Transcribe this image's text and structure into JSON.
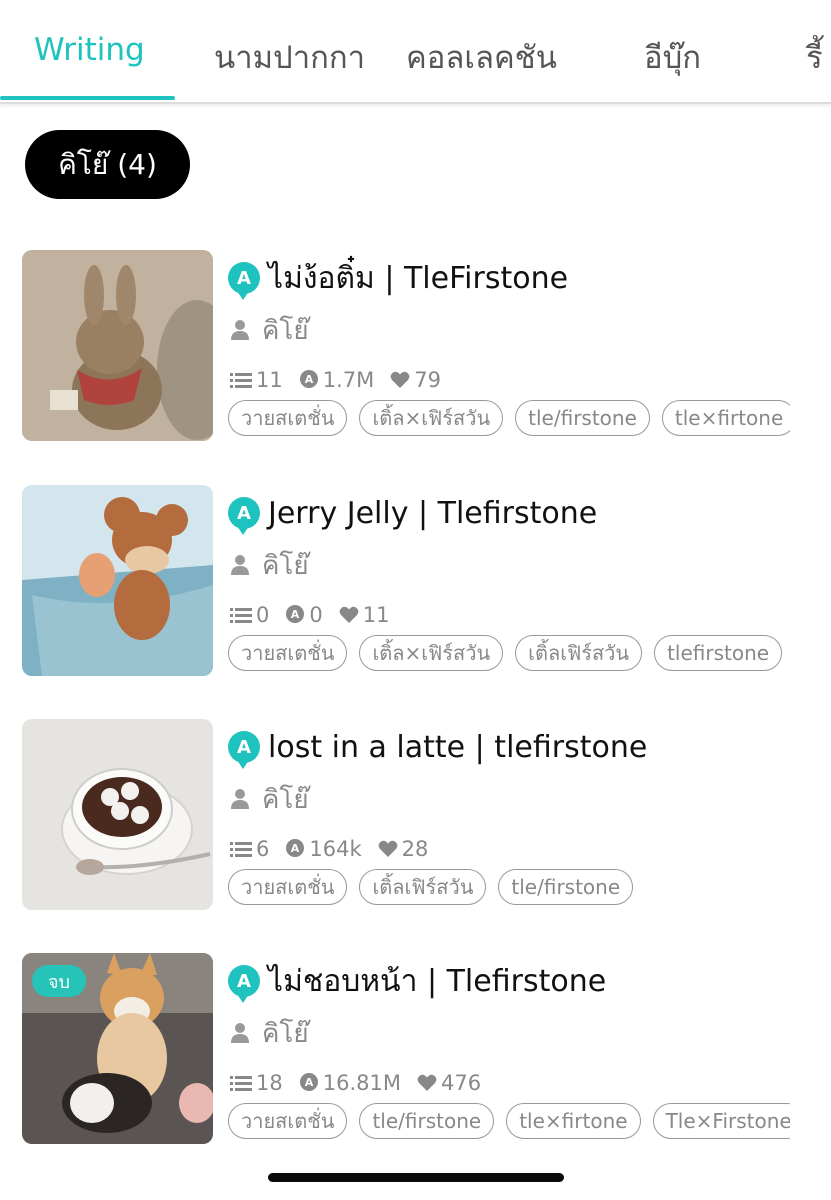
{
  "tabs": [
    "Writing",
    "นามปากกา",
    "คอลเลคชัน",
    "อีบุ๊ก",
    "รี้"
  ],
  "filter_pill": "คิโย๊ (4)",
  "colors": {
    "accent": "#1ec3bf",
    "end_badge": "#25c3b8"
  },
  "items": [
    {
      "title": "ไม่ง้อติ๋ม | TleFirstone",
      "author": "คิโย๊",
      "chapters": "11",
      "views": "1.7M",
      "likes": "79",
      "tags": [
        "วายสเตชั่น",
        "เติ้ล×เฟิร์สวัน",
        "tle/firstone",
        "tle×firtone"
      ],
      "end_badge": ""
    },
    {
      "title": "Jerry Jelly | Tlefirstone",
      "author": "คิโย๊",
      "chapters": "0",
      "views": "0",
      "likes": "11",
      "tags": [
        "วายสเตชั่น",
        "เติ้ล×เฟิร์สวัน",
        "เติ้ลเฟิร์สวัน",
        "tlefirstone"
      ],
      "end_badge": ""
    },
    {
      "title": "lost in a latte | tlefirstone",
      "author": "คิโย๊",
      "chapters": "6",
      "views": "164k",
      "likes": "28",
      "tags": [
        "วายสเตชั่น",
        "เติ้ลเฟิร์สวัน",
        "tle/firstone"
      ],
      "end_badge": ""
    },
    {
      "title": "ไม่ชอบหน้า | Tlefirstone",
      "author": "คิโย๊",
      "chapters": "18",
      "views": "16.81M",
      "likes": "476",
      "tags": [
        "วายสเตชั่น",
        "tle/firstone",
        "tle×firtone",
        "Tle×Firstone"
      ],
      "end_badge": "จบ"
    }
  ]
}
